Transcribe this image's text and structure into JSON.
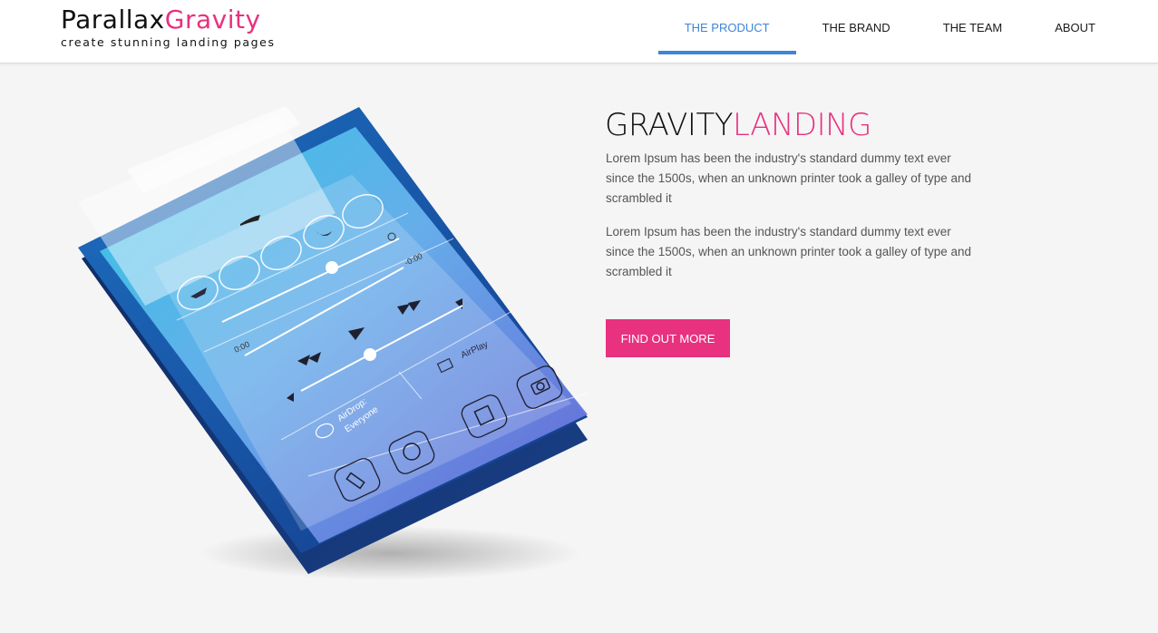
{
  "header": {
    "logo": {
      "part1": "Parallax",
      "part2": "Gravity",
      "tagline": "create stunning landing pages"
    },
    "nav": [
      {
        "label": "THE PRODUCT",
        "active": true
      },
      {
        "label": "THE BRAND",
        "active": false
      },
      {
        "label": "THE TEAM",
        "active": false
      },
      {
        "label": "ABOUT",
        "active": false
      }
    ]
  },
  "hero": {
    "title_part1": "GRAVITY",
    "title_part2": "LANDING",
    "paragraphs": [
      "Lorem Ipsum has been the industry's standard dummy text ever since the 1500s, when an unknown printer took a galley of type and scrambled it",
      "Lorem Ipsum has been the industry's standard dummy text ever since the 1500s, when an unknown printer took a galley of type and scrambled it"
    ],
    "button_label": "FIND OUT MORE"
  },
  "illustration": {
    "time_start": "0:00",
    "time_end": "-0:00",
    "airplay_label": "AirPlay",
    "airdrop_line1": "AirDrop:",
    "airdrop_line2": "Everyone"
  },
  "colors": {
    "accent_pink": "#e8317f",
    "nav_active_blue": "#3d85d6",
    "background": "#f5f5f5"
  }
}
